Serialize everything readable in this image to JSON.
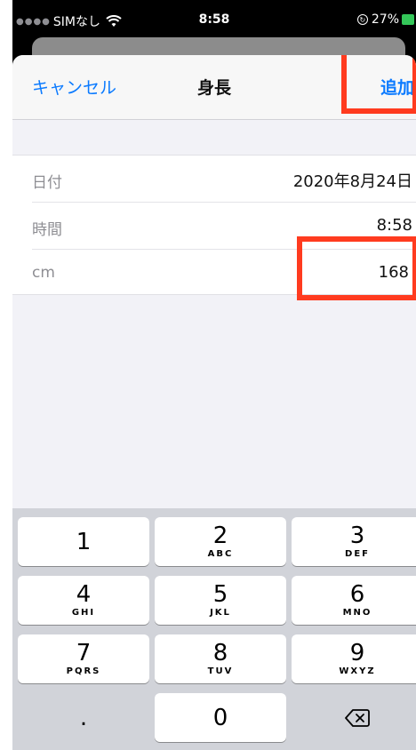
{
  "status_bar": {
    "carrier": "SIMなし",
    "time": "8:58",
    "battery": "27%"
  },
  "nav": {
    "cancel_label": "キャンセル",
    "title": "身長",
    "add_label": "追加"
  },
  "form": {
    "rows": [
      {
        "label": "日付",
        "value": "2020年8月24日"
      },
      {
        "label": "時間",
        "value": "8:58"
      },
      {
        "label": "cm",
        "value": "168"
      }
    ]
  },
  "keypad": {
    "keys": [
      {
        "num": "1",
        "letters": ""
      },
      {
        "num": "2",
        "letters": "ABC"
      },
      {
        "num": "3",
        "letters": "DEF"
      },
      {
        "num": "4",
        "letters": "GHI"
      },
      {
        "num": "5",
        "letters": "JKL"
      },
      {
        "num": "6",
        "letters": "MNO"
      },
      {
        "num": "7",
        "letters": "PQRS"
      },
      {
        "num": "8",
        "letters": "TUV"
      },
      {
        "num": "9",
        "letters": "WXYZ"
      },
      {
        "num": ".",
        "letters": ""
      },
      {
        "num": "0",
        "letters": ""
      }
    ]
  },
  "colors": {
    "accent": "#0a7aff",
    "highlight": "#ff3b1f",
    "battery": "#34c759"
  },
  "icons": {
    "wifi": "wifi-icon",
    "rotation_lock": "rotation-lock-icon",
    "battery": "battery-icon",
    "delete": "delete-backspace-icon"
  }
}
